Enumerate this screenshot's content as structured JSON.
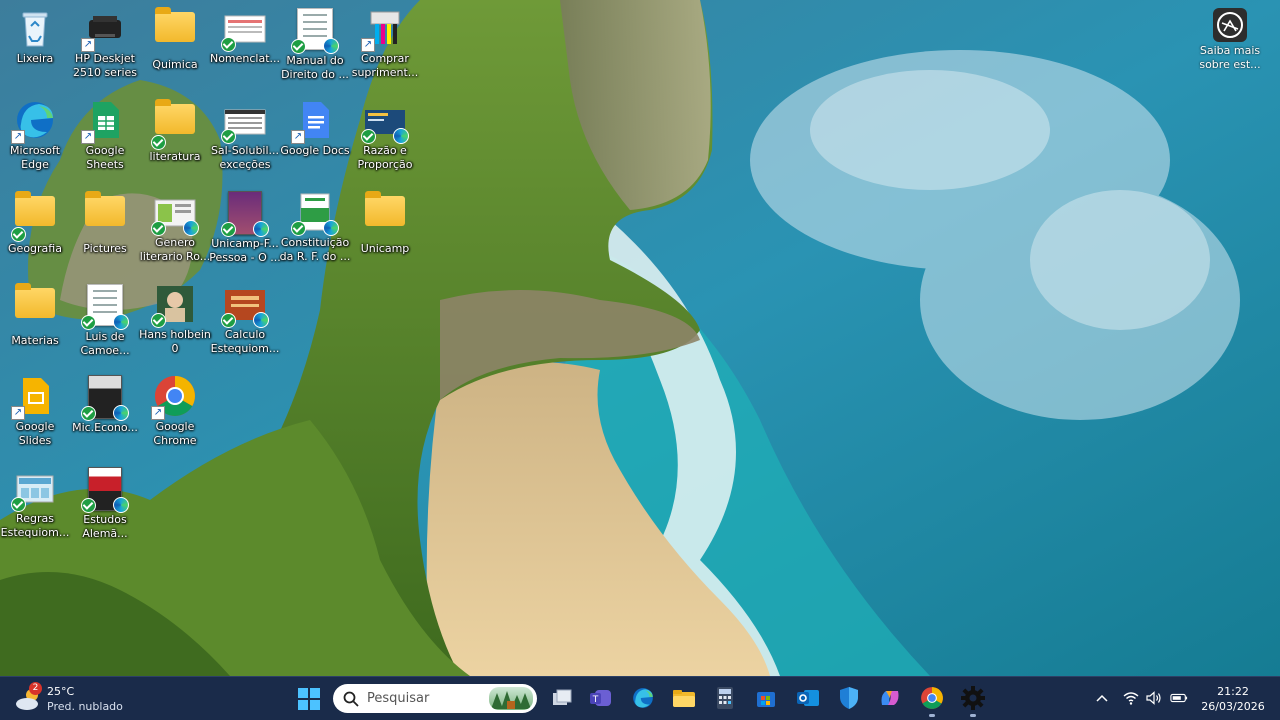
{
  "desktop": {
    "icons": [
      {
        "name": "recycle-bin-icon",
        "label": "Lixeira"
      },
      {
        "name": "printer-icon",
        "label": "HP Deskjet 2510 series"
      },
      {
        "name": "folder-icon",
        "label": "Quimica"
      },
      {
        "name": "document-icon",
        "label": "Nomenclat..."
      },
      {
        "name": "document-icon",
        "label": "Manual do Direito do ..."
      },
      {
        "name": "printer-supplies-icon",
        "label": "Comprar supriment..."
      },
      {
        "name": "edge-icon",
        "label": "Microsoft Edge"
      },
      {
        "name": "google-sheets-icon",
        "label": "Google Sheets"
      },
      {
        "name": "folder-icon",
        "label": "literatura"
      },
      {
        "name": "document-icon",
        "label": "Sal-Solubil... exceções"
      },
      {
        "name": "google-docs-icon",
        "label": "Google Docs"
      },
      {
        "name": "edge-document-icon",
        "label": "Razão e Proporção"
      },
      {
        "name": "folder-icon",
        "label": "Geografia"
      },
      {
        "name": "folder-icon",
        "label": "Pictures"
      },
      {
        "name": "document-icon",
        "label": "Genero literario Ro..."
      },
      {
        "name": "book-icon",
        "label": "Unicamp-F... Pessoa - O ..."
      },
      {
        "name": "document-icon",
        "label": "Constituição da R. F. do ..."
      },
      {
        "name": "folder-icon",
        "label": "Unicamp"
      },
      {
        "name": "folder-icon",
        "label": "Materias"
      },
      {
        "name": "document-icon",
        "label": "Luis de Camoe..."
      },
      {
        "name": "image-icon",
        "label": "Hans holbein 0"
      },
      {
        "name": "document-icon",
        "label": "Calculo Estequiom..."
      },
      {
        "name": "google-slides-icon",
        "label": "Google Slides"
      },
      {
        "name": "book-icon",
        "label": "Mic.Econo..."
      },
      {
        "name": "chrome-icon",
        "label": "Google Chrome"
      },
      {
        "name": "document-icon",
        "label": "Regras Estequiom..."
      },
      {
        "name": "book-icon",
        "label": "Estudos Alemã..."
      }
    ],
    "spotlight": {
      "label": "Saiba mais sobre est..."
    }
  },
  "taskbar": {
    "weather": {
      "temp": "25°C",
      "condition": "Pred. nublado",
      "notifications": "2"
    },
    "search_placeholder": "Pesquisar",
    "apps": [
      "task-view",
      "teams",
      "edge",
      "file-explorer",
      "calculator",
      "microsoft-store",
      "outlook",
      "defender",
      "copilot",
      "chrome",
      "settings"
    ],
    "clock": {
      "time": "21:22",
      "date": "26/03/2026"
    }
  },
  "colors": {
    "taskbar": "#1a2b4a",
    "sea": "#1f86a6",
    "cliff": "#5c8a2c",
    "sand": "#e2c592"
  }
}
